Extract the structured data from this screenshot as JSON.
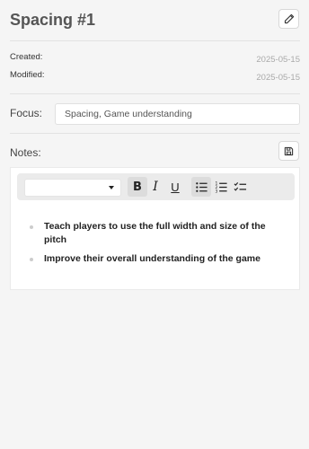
{
  "header": {
    "title": "Spacing #1"
  },
  "meta": {
    "created_label": "Created:",
    "created_value": "2025-05-15",
    "modified_label": "Modified:",
    "modified_value": "2025-05-15"
  },
  "focus": {
    "label": "Focus:",
    "value": "Spacing, Game understanding"
  },
  "notes": {
    "label": "Notes:",
    "toolbar": {
      "font_select_value": "",
      "bold_label": "B",
      "italic_label": "I",
      "underline_label": "U",
      "icons": [
        "pencil-icon",
        "save-icon",
        "bullet-list-icon",
        "numbered-list-icon",
        "checklist-icon"
      ]
    },
    "items": [
      "Teach players to use the full width and size of the pitch",
      "Improve their overall understanding of the game"
    ]
  }
}
